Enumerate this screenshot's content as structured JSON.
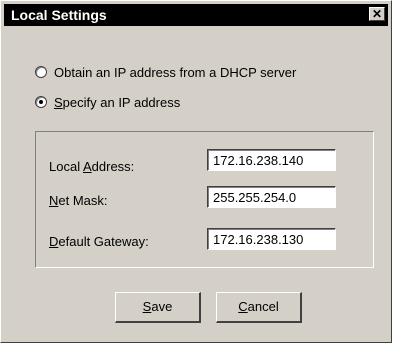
{
  "window": {
    "title": "Local Settings",
    "close_glyph": "✕"
  },
  "options": {
    "dhcp": {
      "label": "Obtain an IP address from a DHCP server",
      "selected": false
    },
    "static": {
      "accel": "S",
      "label_rest": "pecify an IP address",
      "selected": true
    }
  },
  "fields": {
    "local_address": {
      "label_pre": "Local ",
      "accel": "A",
      "label_post": "ddress:",
      "value": "172.16.238.140"
    },
    "net_mask": {
      "label_pre": "",
      "accel": "N",
      "label_post": "et Mask:",
      "value": "255.255.254.0"
    },
    "default_gateway": {
      "label_pre": "",
      "accel": "D",
      "label_post": "efault Gateway:",
      "value": "172.16.238.130"
    }
  },
  "buttons": {
    "save": {
      "accel": "S",
      "label_rest": "ave"
    },
    "cancel": {
      "accel": "C",
      "label_rest": "ancel"
    }
  }
}
